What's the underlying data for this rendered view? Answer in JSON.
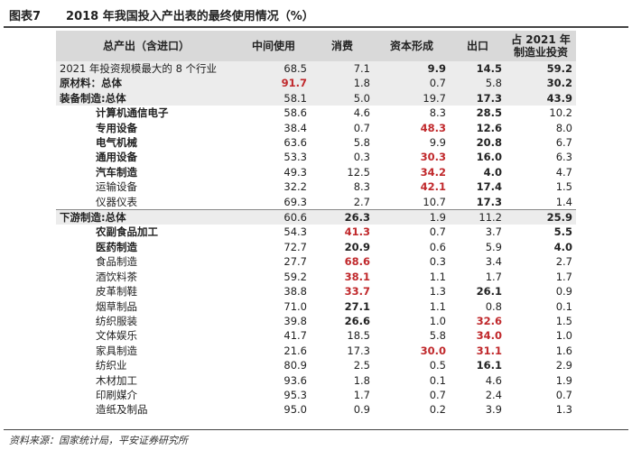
{
  "header": {
    "fig_label": "图表7",
    "title": "2018 年我国投入产出表的最终使用情况（%）"
  },
  "columns": [
    "总产出（含进口）",
    "中间使用",
    "消费",
    "资本形成",
    "出口",
    "占 2021 年\n制造业投资"
  ],
  "rows": [
    {
      "label": "2021 年投资规模最大的 8 个行业",
      "style": "group",
      "indent": 0,
      "bold_label": false,
      "cells": [
        "68.5",
        "7.1",
        "9.9",
        "14.5",
        "59.2"
      ],
      "cell_style": [
        "",
        "",
        "b",
        "b",
        "b"
      ]
    },
    {
      "label": "原材料：总体",
      "style": "group",
      "indent": 0,
      "bold_label": true,
      "cells": [
        "91.7",
        "1.8",
        "0.7",
        "5.8",
        "30.2"
      ],
      "cell_style": [
        "red",
        "",
        "",
        "",
        "b"
      ]
    },
    {
      "label": "装备制造:总体",
      "style": "group",
      "indent": 0,
      "bold_label": true,
      "cells": [
        "58.1",
        "5.0",
        "19.7",
        "17.3",
        "43.9"
      ],
      "cell_style": [
        "",
        "",
        "",
        "b",
        "b"
      ]
    },
    {
      "label": "计算机通信电子",
      "style": "plain",
      "indent": 1,
      "bold_label": true,
      "cells": [
        "58.6",
        "4.6",
        "8.3",
        "28.5",
        "10.2"
      ],
      "cell_style": [
        "",
        "",
        "",
        "b",
        ""
      ]
    },
    {
      "label": "专用设备",
      "style": "plain",
      "indent": 1,
      "bold_label": true,
      "cells": [
        "38.4",
        "0.7",
        "48.3",
        "12.6",
        "8.0"
      ],
      "cell_style": [
        "",
        "",
        "red",
        "b",
        ""
      ]
    },
    {
      "label": "电气机械",
      "style": "plain",
      "indent": 1,
      "bold_label": true,
      "cells": [
        "63.6",
        "5.8",
        "9.9",
        "20.8",
        "6.7"
      ],
      "cell_style": [
        "",
        "",
        "",
        "b",
        ""
      ]
    },
    {
      "label": "通用设备",
      "style": "plain",
      "indent": 1,
      "bold_label": true,
      "cells": [
        "53.3",
        "0.3",
        "30.3",
        "16.0",
        "6.3"
      ],
      "cell_style": [
        "",
        "",
        "red",
        "b",
        ""
      ]
    },
    {
      "label": "汽车制造",
      "style": "plain",
      "indent": 1,
      "bold_label": true,
      "cells": [
        "49.3",
        "12.5",
        "34.2",
        "4.0",
        "4.7"
      ],
      "cell_style": [
        "",
        "",
        "red",
        "b",
        ""
      ]
    },
    {
      "label": "运输设备",
      "style": "plain",
      "indent": 1,
      "bold_label": false,
      "cells": [
        "32.2",
        "8.3",
        "42.1",
        "17.4",
        "1.5"
      ],
      "cell_style": [
        "",
        "",
        "red",
        "b",
        ""
      ]
    },
    {
      "label": "仪器仪表",
      "style": "plain",
      "indent": 1,
      "bold_label": false,
      "cells": [
        "69.3",
        "2.7",
        "10.7",
        "17.3",
        "1.4"
      ],
      "cell_style": [
        "",
        "",
        "",
        "b",
        ""
      ]
    },
    {
      "label": "下游制造:总体",
      "style": "group",
      "indent": 0,
      "bold_label": true,
      "cells": [
        "60.6",
        "26.3",
        "1.9",
        "11.2",
        "25.9"
      ],
      "cell_style": [
        "",
        "b",
        "",
        "",
        "b"
      ]
    },
    {
      "label": "农副食品加工",
      "style": "plain",
      "indent": 1,
      "bold_label": true,
      "cells": [
        "54.3",
        "41.3",
        "0.7",
        "3.7",
        "5.5"
      ],
      "cell_style": [
        "",
        "red",
        "",
        "",
        "b"
      ]
    },
    {
      "label": "医药制造",
      "style": "plain",
      "indent": 1,
      "bold_label": true,
      "cells": [
        "72.7",
        "20.9",
        "0.6",
        "5.9",
        "4.0"
      ],
      "cell_style": [
        "",
        "b",
        "",
        "",
        "b"
      ]
    },
    {
      "label": "食品制造",
      "style": "plain",
      "indent": 1,
      "bold_label": false,
      "cells": [
        "27.7",
        "68.6",
        "0.3",
        "3.4",
        "2.7"
      ],
      "cell_style": [
        "",
        "red",
        "",
        "",
        ""
      ]
    },
    {
      "label": "酒饮料茶",
      "style": "plain",
      "indent": 1,
      "bold_label": false,
      "cells": [
        "59.2",
        "38.1",
        "1.1",
        "1.7",
        "1.7"
      ],
      "cell_style": [
        "",
        "red",
        "",
        "",
        ""
      ]
    },
    {
      "label": "皮革制鞋",
      "style": "plain",
      "indent": 1,
      "bold_label": false,
      "cells": [
        "38.8",
        "33.7",
        "1.3",
        "26.1",
        "0.9"
      ],
      "cell_style": [
        "",
        "red",
        "",
        "b",
        ""
      ]
    },
    {
      "label": "烟草制品",
      "style": "plain",
      "indent": 1,
      "bold_label": false,
      "cells": [
        "71.0",
        "27.1",
        "1.1",
        "0.8",
        "0.1"
      ],
      "cell_style": [
        "",
        "b",
        "",
        "",
        ""
      ]
    },
    {
      "label": "纺织服装",
      "style": "plain",
      "indent": 1,
      "bold_label": false,
      "cells": [
        "39.8",
        "26.6",
        "1.0",
        "32.6",
        "1.5"
      ],
      "cell_style": [
        "",
        "b",
        "",
        "red",
        ""
      ]
    },
    {
      "label": "文体娱乐",
      "style": "plain",
      "indent": 1,
      "bold_label": false,
      "cells": [
        "41.7",
        "18.5",
        "5.8",
        "34.0",
        "1.0"
      ],
      "cell_style": [
        "",
        "",
        "",
        "red",
        ""
      ]
    },
    {
      "label": "家具制造",
      "style": "plain",
      "indent": 1,
      "bold_label": false,
      "cells": [
        "21.6",
        "17.3",
        "30.0",
        "31.1",
        "1.6"
      ],
      "cell_style": [
        "",
        "",
        "red",
        "red",
        ""
      ]
    },
    {
      "label": "纺织业",
      "style": "plain",
      "indent": 1,
      "bold_label": false,
      "cells": [
        "80.9",
        "2.5",
        "0.5",
        "16.1",
        "2.9"
      ],
      "cell_style": [
        "",
        "",
        "",
        "b",
        ""
      ]
    },
    {
      "label": "木材加工",
      "style": "plain",
      "indent": 1,
      "bold_label": false,
      "cells": [
        "93.6",
        "1.8",
        "0.1",
        "4.6",
        "1.9"
      ],
      "cell_style": [
        "",
        "",
        "",
        "",
        ""
      ]
    },
    {
      "label": "印刷媒介",
      "style": "plain",
      "indent": 1,
      "bold_label": false,
      "cells": [
        "95.3",
        "1.7",
        "0.7",
        "2.4",
        "0.7"
      ],
      "cell_style": [
        "",
        "",
        "",
        "",
        ""
      ]
    },
    {
      "label": "造纸及制品",
      "style": "plain",
      "indent": 1,
      "bold_label": false,
      "cells": [
        "95.0",
        "0.9",
        "0.2",
        "3.9",
        "1.3"
      ],
      "cell_style": [
        "",
        "",
        "",
        "",
        ""
      ]
    }
  ],
  "footer": {
    "source": "资料来源：国家统计局，平安证券研究所"
  }
}
